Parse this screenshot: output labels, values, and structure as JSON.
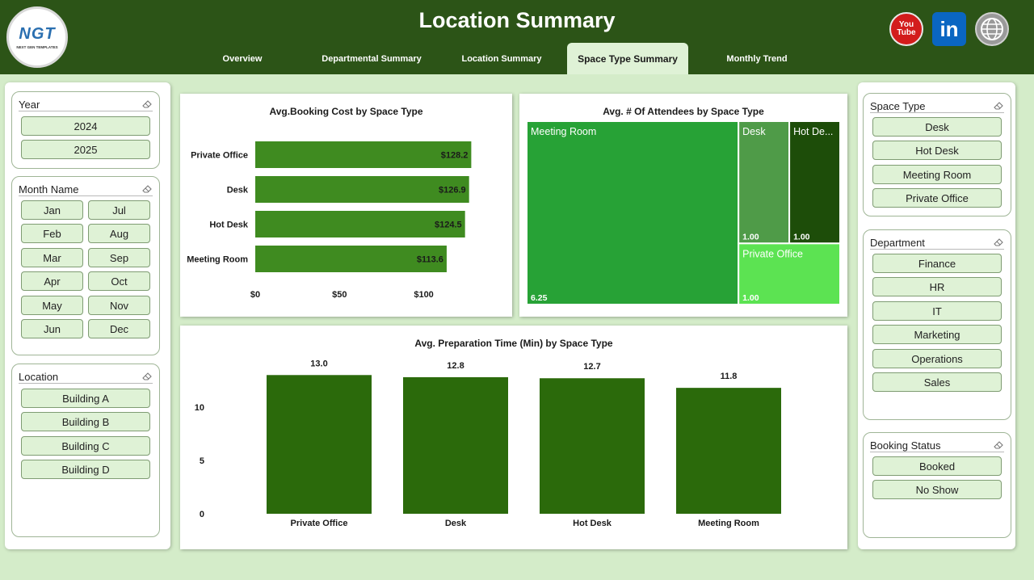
{
  "header": {
    "title": "Location Summary",
    "logo_text": "NGT",
    "logo_sub": "NEXT GEN TEMPLATES",
    "tabs": [
      {
        "label": "Overview"
      },
      {
        "label": "Departmental Summary"
      },
      {
        "label": "Location Summary"
      },
      {
        "label": "Space Type Summary"
      },
      {
        "label": "Monthly Trend"
      }
    ],
    "youtube": "You Tube",
    "linkedin": "in"
  },
  "slicers_left": {
    "year": {
      "title": "Year",
      "items": [
        "2024",
        "2025"
      ]
    },
    "month": {
      "title": "Month Name",
      "items": [
        "Jan",
        "Jul",
        "Feb",
        "Aug",
        "Mar",
        "Sep",
        "Apr",
        "Oct",
        "May",
        "Nov",
        "Jun",
        "Dec"
      ]
    },
    "location": {
      "title": "Location",
      "items": [
        "Building A",
        "Building B",
        "Building C",
        "Building D"
      ]
    }
  },
  "slicers_right": {
    "space_type": {
      "title": "Space Type",
      "items": [
        "Desk",
        "Hot Desk",
        "Meeting Room",
        "Private Office"
      ]
    },
    "department": {
      "title": "Department",
      "items": [
        "Finance",
        "HR",
        "IT",
        "Marketing",
        "Operations",
        "Sales"
      ]
    },
    "booking_status": {
      "title": "Booking Status",
      "items": [
        "Booked",
        "No Show"
      ]
    }
  },
  "colors": {
    "header": "#2c5417",
    "bar_hbar": "#3f8b20",
    "bar_col": "#2b6a0b",
    "tm_meeting": "#27a236",
    "tm_desk": "#4f9b48",
    "tm_hotdesk": "#1d4d09",
    "tm_private": "#5ce352"
  },
  "chart_data": [
    {
      "type": "bar",
      "orientation": "horizontal",
      "title": "Avg.Booking Cost by Space Type",
      "categories": [
        "Private Office",
        "Desk",
        "Hot Desk",
        "Meeting Room"
      ],
      "values": [
        128.2,
        126.9,
        124.5,
        113.6
      ],
      "labels": [
        "$128.2",
        "$126.9",
        "$124.5",
        "$113.6"
      ],
      "xticks": [
        "$0",
        "$50",
        "$100"
      ],
      "xtick_values": [
        0,
        50,
        100
      ],
      "xlim": [
        0,
        140
      ]
    },
    {
      "type": "treemap",
      "title": "Avg. # Of Attendees by Space Type",
      "categories": [
        "Meeting Room",
        "Desk",
        "Hot De...",
        "Private Office"
      ],
      "values": [
        6.25,
        1.0,
        1.0,
        1.0
      ],
      "labels": [
        "6.25",
        "1.00",
        "1.00",
        "1.00"
      ]
    },
    {
      "type": "bar",
      "title": "Avg. Preparation Time (Min) by Space Type",
      "categories": [
        "Private Office",
        "Desk",
        "Hot Desk",
        "Meeting Room"
      ],
      "values": [
        13.0,
        12.8,
        12.7,
        11.8
      ],
      "labels": [
        "13.0",
        "12.8",
        "12.7",
        "11.8"
      ],
      "yticks": [
        "0",
        "5",
        "10"
      ],
      "ytick_values": [
        0,
        5,
        10
      ],
      "ylim": [
        0,
        13.4
      ]
    }
  ]
}
